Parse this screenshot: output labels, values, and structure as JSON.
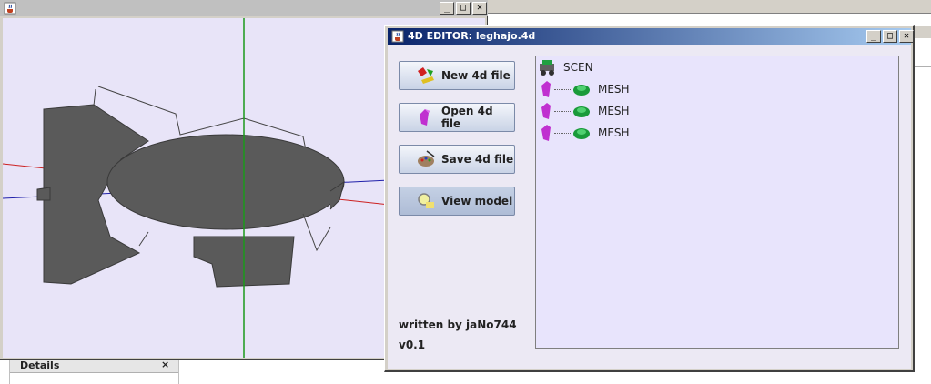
{
  "viewer": {
    "buttons": {
      "minimize": "_",
      "maximize": "□",
      "close": "✕"
    }
  },
  "details": {
    "title": "Details",
    "close": "×"
  },
  "editor": {
    "title": "4D EDITOR: leghajo.4d",
    "window_buttons": {
      "minimize": "_",
      "maximize": "□",
      "close": "✕"
    },
    "buttons": [
      {
        "label": "New 4d file",
        "icon": "shapes-icon"
      },
      {
        "label": "Open 4d file",
        "icon": "crystal-icon"
      },
      {
        "label": "Save 4d file",
        "icon": "palette-icon"
      },
      {
        "label": "View model",
        "icon": "lens-icon"
      }
    ],
    "credit": "written by jaNo744",
    "version": "v0.1",
    "tree": {
      "root": "SCEN",
      "children": [
        "MESH",
        "MESH",
        "MESH"
      ]
    }
  },
  "colors": {
    "viewport_bg": "#e8e4f8",
    "axis_green": "#1a9a1a",
    "axis_red": "#cc2020",
    "axis_blue": "#2020aa",
    "model_gray": "#5a5a5a",
    "titlebar_start": "#0a246a",
    "titlebar_end": "#a6caf0",
    "tree_bg": "#e8e4fc"
  }
}
